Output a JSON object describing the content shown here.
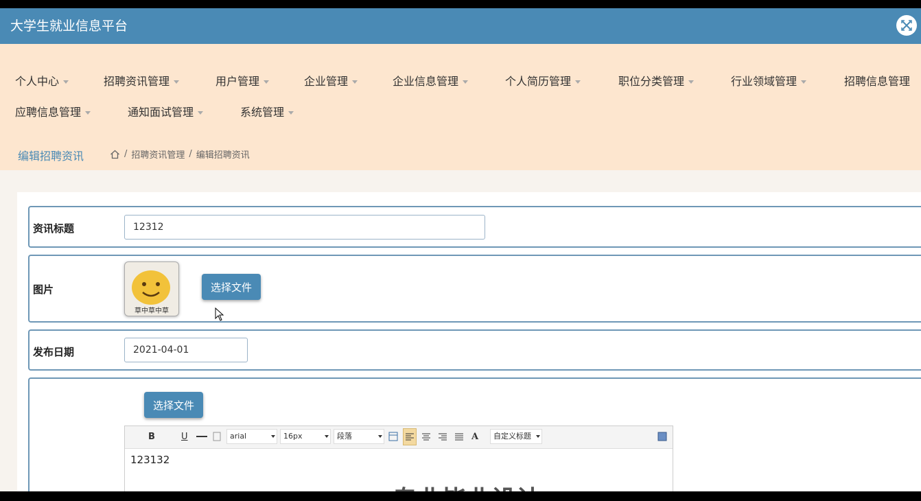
{
  "app": {
    "title": "大学生就业信息平台"
  },
  "nav": [
    {
      "label": "个人中心"
    },
    {
      "label": "招聘资讯管理"
    },
    {
      "label": "用户管理"
    },
    {
      "label": "企业管理"
    },
    {
      "label": "企业信息管理"
    },
    {
      "label": "个人简历管理"
    },
    {
      "label": "职位分类管理"
    },
    {
      "label": "行业领域管理"
    },
    {
      "label": "招聘信息管理"
    },
    {
      "label": "应聘信息管理"
    },
    {
      "label": "通知面试管理"
    },
    {
      "label": "系统管理"
    }
  ],
  "breadcrumb": {
    "title": "编辑招聘资讯",
    "sep": "/",
    "items": [
      "招聘资讯管理",
      "编辑招聘资讯"
    ]
  },
  "form": {
    "title_label": "资讯标题",
    "title_value": "12312",
    "image_label": "图片",
    "image_caption": "草中草中草",
    "image_button": "选择文件",
    "date_label": "发布日期",
    "date_value": "2021-04-01",
    "content_button": "选择文件"
  },
  "editor": {
    "bold": "B",
    "underline": "U",
    "font_family": "arial",
    "font_size": "16px",
    "paragraph": "段落",
    "font_color": "A",
    "custom_title": "自定义标题",
    "body_text": "123132",
    "heading_text": "专业毕业设计"
  },
  "colors": {
    "primary": "#4a8ab5",
    "nav_bg": "#fde6cf",
    "page_bg": "#f7f3ee"
  }
}
